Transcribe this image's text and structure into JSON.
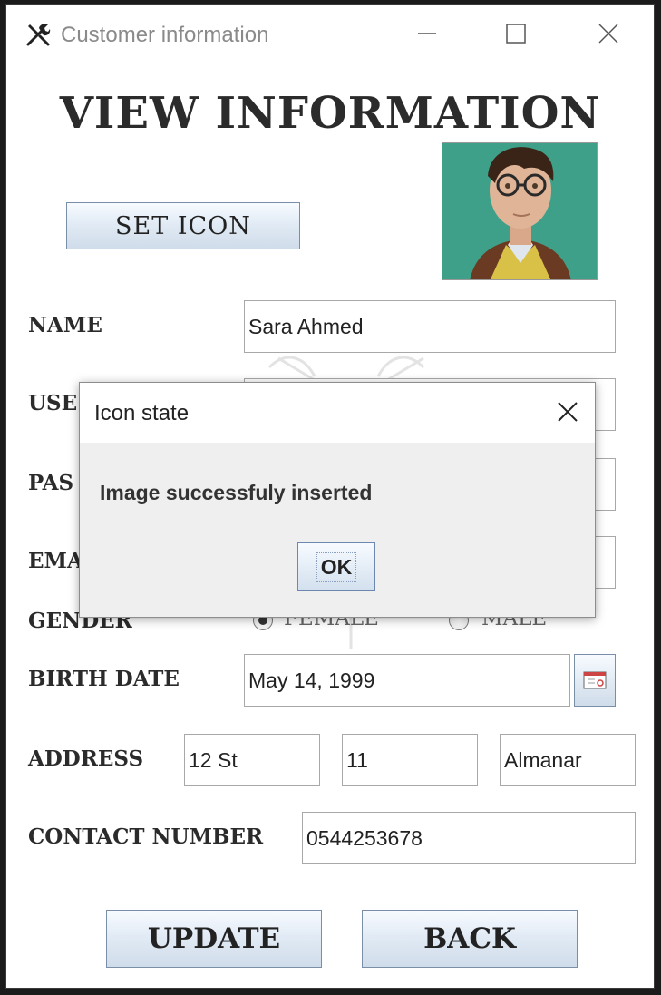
{
  "window": {
    "title": "Customer information",
    "app_icon": "tools-icon",
    "controls": [
      "minimize",
      "maximize",
      "close"
    ]
  },
  "form": {
    "heading": "VIEW INFORMATION",
    "set_icon_label": "SET ICON",
    "photo_alt": "customer-photo",
    "labels": {
      "name": "NAME",
      "username": "USE",
      "password": "PAS",
      "email": "EMA",
      "gender": "GENDER",
      "birth_date": "BIRTH DATE",
      "address": "ADDRESS",
      "contact": "CONTACT NUMBER"
    },
    "values": {
      "name": "Sara Ahmed",
      "birth_date": "May 14, 1999",
      "address_street": "12 St",
      "address_number": "11",
      "address_area": "Almanar",
      "contact": "0544253678"
    },
    "gender": {
      "options": [
        "FEMALE",
        "MALE"
      ],
      "selected": "FEMALE"
    },
    "update_label": "UPDATE",
    "back_label": "BACK"
  },
  "dialog": {
    "title": "Icon state",
    "message": "Image successfuly inserted",
    "ok_label": "OK"
  },
  "colors": {
    "button_border": "#7a8ea8",
    "button_top": "#f7fbff",
    "button_bottom": "#cfdcea",
    "photo_bg": "#3fa08a"
  }
}
